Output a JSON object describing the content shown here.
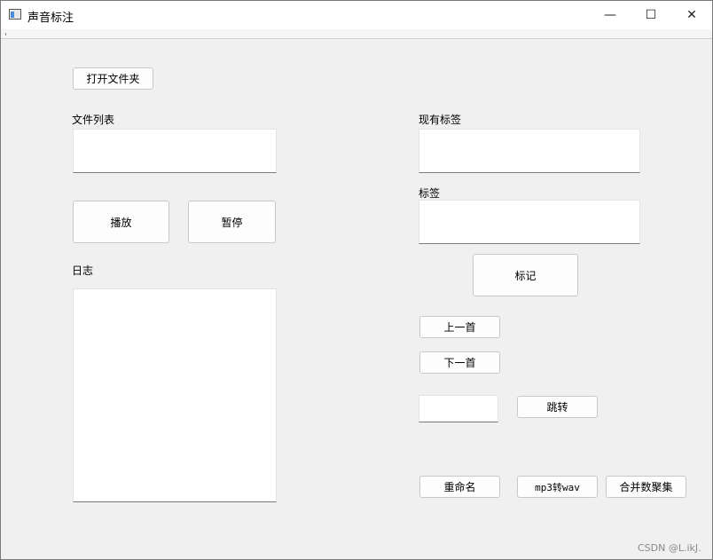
{
  "window": {
    "title": "声音标注",
    "controls": {
      "minimize": "—",
      "maximize": "☐",
      "close": "✕"
    }
  },
  "left_panel": {
    "open_folder_button": "打开文件夹",
    "file_list_label": "文件列表",
    "play_button": "播放",
    "pause_button": "暂停",
    "log_label": "日志"
  },
  "right_panel": {
    "existing_tags_label": "现有标签",
    "tag_label": "标签",
    "mark_button": "标记",
    "prev_button": "上一首",
    "next_button": "下一首",
    "jump_input_value": "",
    "jump_button": "跳转",
    "rename_button": "重命名",
    "mp3_to_wav_button": "mp3转wav",
    "merge_dataset_button": "合并数聚集"
  },
  "watermark": "CSDN @L.ikJ."
}
